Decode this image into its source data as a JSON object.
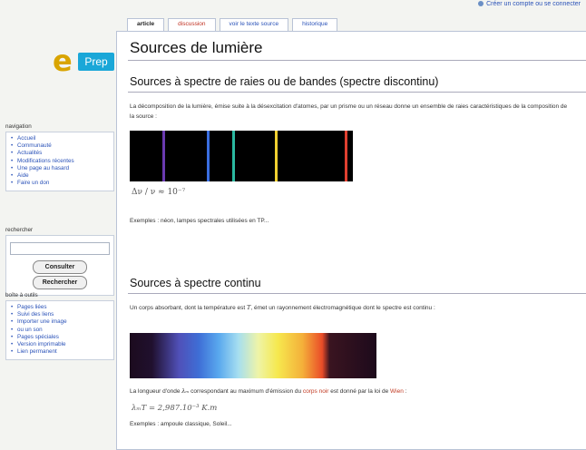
{
  "personal": {
    "login": "Créer un compte ou se connecter"
  },
  "tabs": [
    "article",
    "discussion",
    "voir le texte source",
    "historique"
  ],
  "logo": {
    "letter": "e",
    "word": "Prep"
  },
  "sidebar": {
    "navigation_title": "navigation",
    "navigation_items": [
      "Accueil",
      "Communauté",
      "Actualités",
      "Modifications récentes",
      "Une page au hasard",
      "Aide",
      "Faire un don"
    ],
    "search_title": "rechercher",
    "search_buttons": [
      "Consulter",
      "Rechercher"
    ],
    "toolbox_title": "boîte à outils",
    "toolbox_items": [
      "Pages liées",
      "Suivi des liens",
      "Importer une image",
      "ou un son",
      "Pages spéciales",
      "Version imprimable",
      "Lien permanent"
    ]
  },
  "content": {
    "title": "Sources de lumière",
    "section1": {
      "heading": "Sources à spectre de raies ou de bandes (spectre discontinu)",
      "text": "La décomposition de la lumière, émise suite à la désexcitation d'atomes, par un prisme ou un réseau donne un ensemble de raies caractéristiques de la composition de la source :",
      "line_colors": [
        "#6a3ab0",
        "#3a6ee0",
        "#2bb8a0",
        "#f0d030",
        "#e04030"
      ],
      "formula": "Δν / ν ≈ 10⁻⁷",
      "examples": "Exemples : néon, lampes spectrales utilisées en TP..."
    },
    "section2": {
      "heading": "Sources à spectre continu",
      "text_before": "Un corps absorbant, dont la température est ",
      "text_T": "T",
      "text_after": ", émet un rayonnement électromagnétique dont le spectre est continu :",
      "wien_before": "La longueur d'onde ",
      "wien_symbol": "λₘ",
      "wien_middle": " correspondant au maximum d'émission du ",
      "wien_link1": "corps noir",
      "wien_between": " est donné par la loi de ",
      "wien_link2": "Wien",
      "wien_end": " :",
      "formula": "λₘT = 2,987.10⁻³ K.m",
      "examples": "Exemples : ampoule classique, Soleil..."
    }
  }
}
